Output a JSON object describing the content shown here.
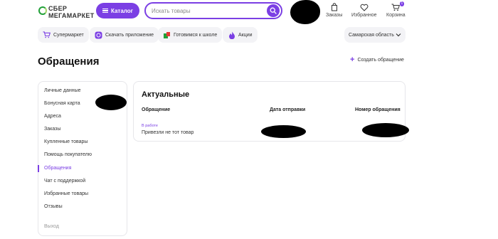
{
  "header": {
    "logo_line1": "СБЕР",
    "logo_line2": "МЕГАМАРКЕТ",
    "catalog_label": "Каталог",
    "search_placeholder": "Искать товары",
    "nav": [
      {
        "label": "Заказы",
        "icon": "bag-icon"
      },
      {
        "label": "Избранное",
        "icon": "heart-icon"
      },
      {
        "label": "Корзина",
        "icon": "cart-icon",
        "badge": "1"
      }
    ]
  },
  "chips": [
    {
      "label": "Супермаркет",
      "icon": "cart-icon"
    },
    {
      "label": "Скачать приложение",
      "icon": "app-icon"
    },
    {
      "label": "Готовимся к школе",
      "icon": "school-icon"
    },
    {
      "label": "Акции",
      "icon": "flame-icon"
    }
  ],
  "region": "Самарская область",
  "page": {
    "title": "Обращения",
    "create_label": "Создать обращение"
  },
  "sidebar": {
    "items": [
      {
        "label": "Личные данные"
      },
      {
        "label": "Бонусная карта"
      },
      {
        "label": "Адреса"
      },
      {
        "label": "Заказы"
      },
      {
        "label": "Купленные товары"
      },
      {
        "label": "Помощь покупателю"
      },
      {
        "label": "Обращения",
        "active": true
      },
      {
        "label": "Чат с поддержкой"
      },
      {
        "label": "Избранные товары"
      },
      {
        "label": "Отзывы"
      }
    ],
    "logout": "Выход"
  },
  "card": {
    "title": "Актуальные",
    "columns": [
      "Обращение",
      "Дата отправки",
      "Номер обращения"
    ],
    "rows": [
      {
        "status": "В работе",
        "subject": "Привезли не тот товар"
      }
    ]
  },
  "colors": {
    "accent": "#7b3fe4",
    "brand_green": "#21a038"
  }
}
